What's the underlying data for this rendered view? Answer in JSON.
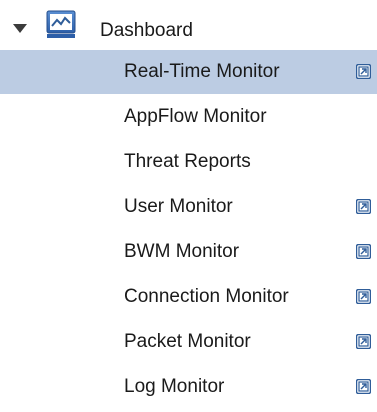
{
  "nav": {
    "section": {
      "label": "Dashboard",
      "expanded": true,
      "icon": "dashboard-chart-icon"
    },
    "items": [
      {
        "id": "real-time-monitor",
        "label": "Real-Time Monitor",
        "selected": true,
        "has_popout": true
      },
      {
        "id": "appflow-monitor",
        "label": "AppFlow Monitor",
        "selected": false,
        "has_popout": false
      },
      {
        "id": "threat-reports",
        "label": "Threat Reports",
        "selected": false,
        "has_popout": false
      },
      {
        "id": "user-monitor",
        "label": "User Monitor",
        "selected": false,
        "has_popout": true
      },
      {
        "id": "bwm-monitor",
        "label": "BWM Monitor",
        "selected": false,
        "has_popout": true
      },
      {
        "id": "connection-monitor",
        "label": "Connection Monitor",
        "selected": false,
        "has_popout": true
      },
      {
        "id": "packet-monitor",
        "label": "Packet Monitor",
        "selected": false,
        "has_popout": true
      },
      {
        "id": "log-monitor",
        "label": "Log Monitor",
        "selected": false,
        "has_popout": true
      }
    ],
    "popout_icon": "popout-window-icon"
  },
  "colors": {
    "selected_row_bg": "#bccce3",
    "icon_blue": "#2f5d99",
    "text": "#1a1a1a"
  }
}
